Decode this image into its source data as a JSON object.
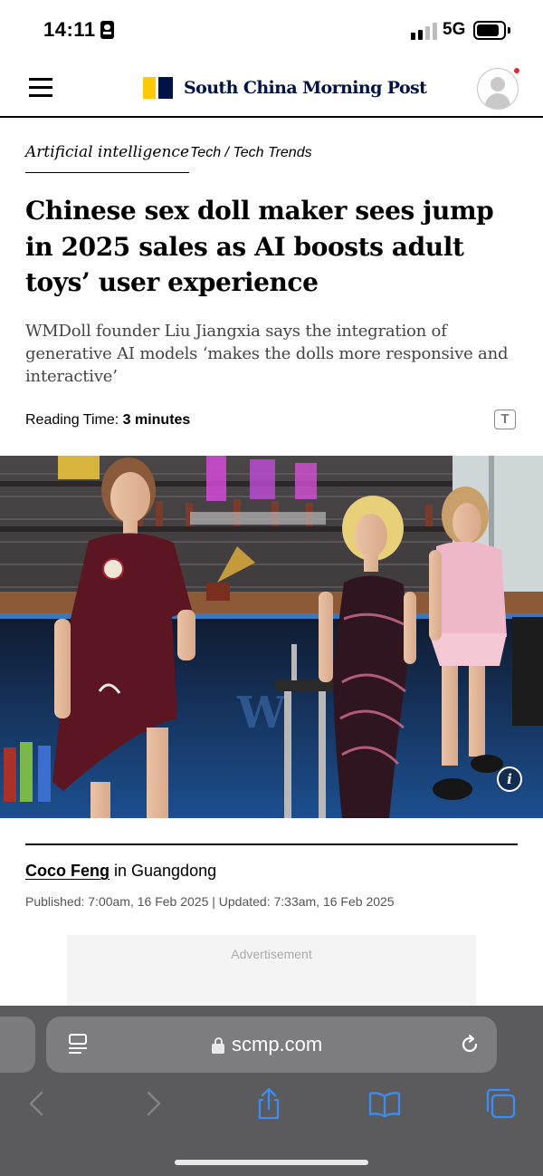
{
  "status_bar": {
    "time": "14:11",
    "network": "5G",
    "battery_level": 0.85
  },
  "header": {
    "logo_text": "South China Morning Post",
    "colors": {
      "logo_yellow": "#ffca05",
      "logo_navy": "#001246",
      "notification_dot": "#e3272e"
    },
    "icons": {
      "menu": "hamburger-menu-icon",
      "profile": "user-avatar-icon"
    }
  },
  "article": {
    "topic_primary": "Artificial intelligence",
    "topic_secondary": "Tech / Tech Trends",
    "headline": "Chinese sex doll maker sees jump in 2025 sales as AI boosts adult toys’ user experience",
    "summary": "WMDoll founder Liu Jiangxia says the integration of generative AI models ‘makes the dolls more responsive and interactive’",
    "reading_time_label": "Reading Time:",
    "reading_time_value": "3 minutes",
    "text_size_glyph": "T",
    "image_info_glyph": "i",
    "author": "Coco Feng",
    "location": " in Guangdong",
    "dates": "Published: 7:00am, 16 Feb 2025 | Updated: 7:33am, 16 Feb 2025",
    "advertisement_label": "Advertisement"
  },
  "browser": {
    "url": "scmp.com",
    "icons": {
      "reader": "reader-mode-icon",
      "lock": "lock-icon",
      "reload": "reload-icon",
      "back": "back-arrow-icon",
      "forward": "forward-arrow-icon",
      "share": "share-icon",
      "bookmarks": "bookmarks-book-icon",
      "tabs": "tabs-icon"
    },
    "colors": {
      "chrome": "#5b5b5d",
      "accent": "#3b8cf5"
    }
  }
}
